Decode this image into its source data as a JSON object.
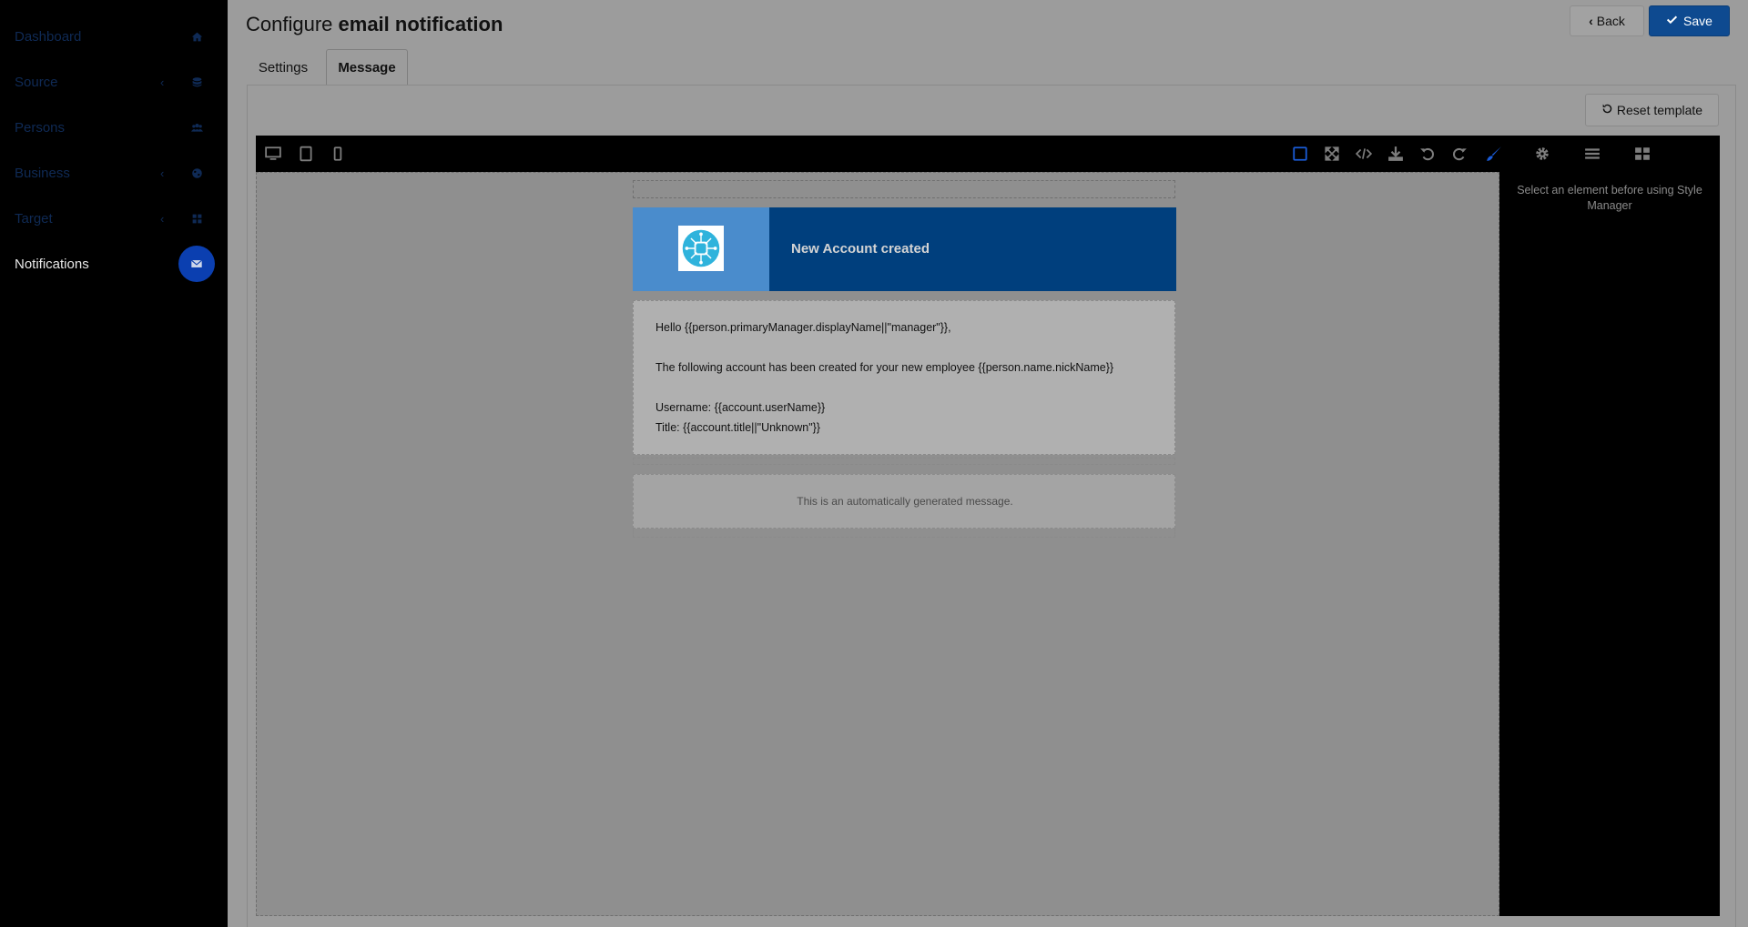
{
  "sidebar": {
    "items": [
      {
        "label": "Dashboard",
        "icon": "home-icon",
        "chevron": ""
      },
      {
        "label": "Source",
        "icon": "database-icon",
        "chevron": "‹"
      },
      {
        "label": "Persons",
        "icon": "users-icon",
        "chevron": ""
      },
      {
        "label": "Business",
        "icon": "globe-icon",
        "chevron": "‹"
      },
      {
        "label": "Target",
        "icon": "grid-icon",
        "chevron": "‹"
      },
      {
        "label": "Notifications",
        "icon": "envelope-icon",
        "chevron": "",
        "active": true
      }
    ]
  },
  "header": {
    "title_prefix": "Configure",
    "title_bold": "email notification",
    "back_label": "Back",
    "save_label": "Save"
  },
  "tabs": [
    {
      "label": "Settings",
      "active": false
    },
    {
      "label": "Message",
      "active": true
    }
  ],
  "editor": {
    "reset_label": "Reset template",
    "style_manager_message": "Select an element before using Style Manager",
    "toolbar_left": [
      "desktop-icon",
      "tablet-icon",
      "mobile-icon"
    ],
    "toolbar_right": [
      "outline-icon",
      "fullscreen-icon",
      "code-icon",
      "import-icon",
      "undo-icon",
      "redo-icon",
      "style-brush-icon",
      "settings-icon",
      "layers-icon",
      "blocks-icon"
    ],
    "active_color": "#1a5bd6"
  },
  "email": {
    "header_title": "New Account created",
    "lines": [
      "Hello {{person.primaryManager.displayName||\"manager\"}},",
      "The following account has been created for your new employee {{person.name.nickName}}",
      "Username: {{account.userName}}",
      "Title: {{account.title||\"Unknown\"}}"
    ],
    "footer": "This is an automatically generated message."
  },
  "colors": {
    "save_button": "#0e4a90",
    "email_header_light": "#4a8ccc",
    "email_header_dark": "#003f7d",
    "notification_badge": "#0b3fb0"
  }
}
